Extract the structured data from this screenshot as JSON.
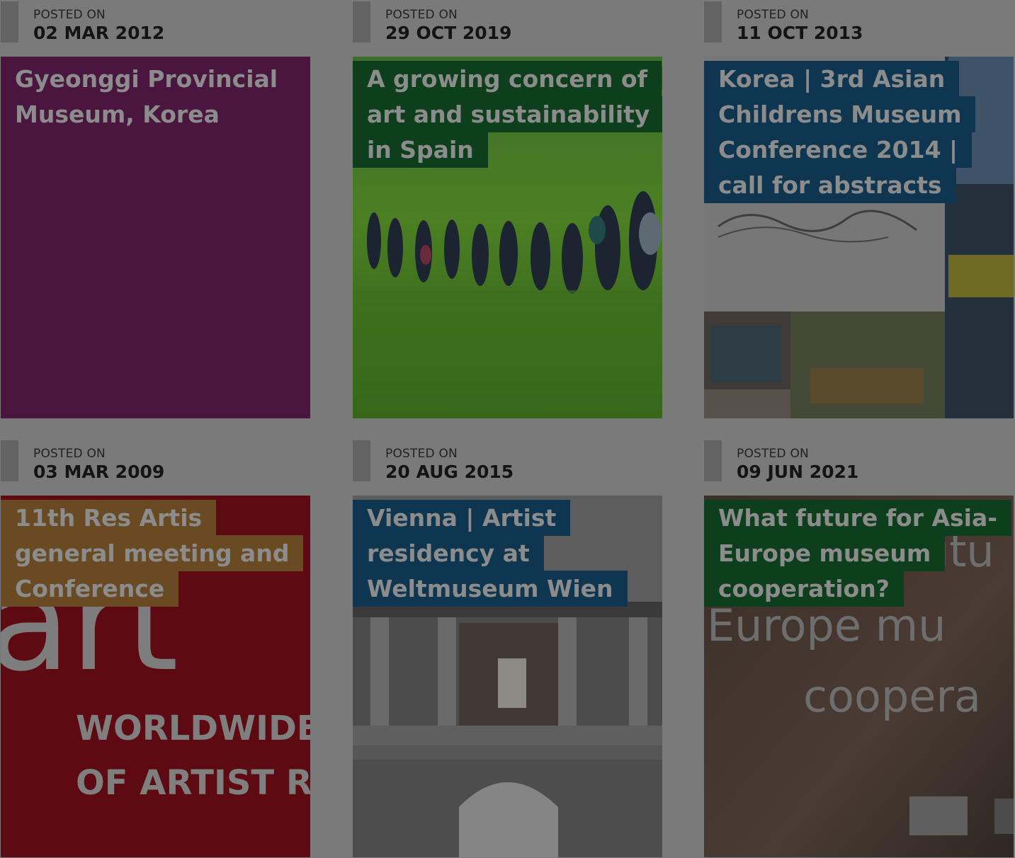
{
  "posts": [
    {
      "posted_label": "POSTED ON",
      "date": "02 MAR 2012",
      "title": "Gyeonggi Provincial Museum, Korea",
      "color": "#4a1640"
    },
    {
      "posted_label": "POSTED ON",
      "date": "29 OCT 2019",
      "title": "A growing concern of art and sustainability in Spain",
      "color": "#0e3f1d"
    },
    {
      "posted_label": "POSTED ON",
      "date": "11 OCT 2013",
      "title": "Korea | 3rd Asian Childrens Museum Conference 2014 | call for abstracts",
      "color": "#0f3651"
    },
    {
      "posted_label": "POSTED ON",
      "date": "03 MAR 2009",
      "title": "11th Res Artis general meeting and Conference",
      "color": "#6a4a22",
      "image_text": [
        "art",
        "WORLDWIDE",
        "OF ARTIST R"
      ]
    },
    {
      "posted_label": "POSTED ON",
      "date": "20 AUG 2015",
      "title": "Vienna | Artist residency at Weltmuseum Wien",
      "color": "#0f3651"
    },
    {
      "posted_label": "POSTED ON",
      "date": "09 JUN 2021",
      "title": "What future for Asia-Europe museum cooperation?",
      "color": "#0e3f1d",
      "image_text": [
        "futu",
        "Europe mu",
        "coopera"
      ]
    }
  ]
}
